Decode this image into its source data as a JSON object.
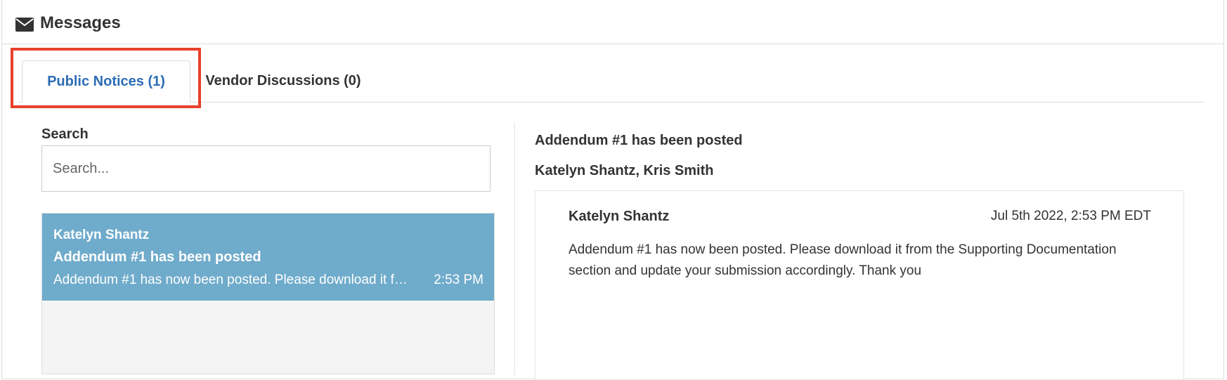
{
  "header": {
    "title": "Messages",
    "icon": "envelope-icon"
  },
  "tabs": [
    {
      "label": "Public Notices (1)",
      "active": true
    },
    {
      "label": "Vendor Discussions (0)",
      "active": false
    }
  ],
  "search": {
    "label": "Search",
    "placeholder": "Search...",
    "value": ""
  },
  "message_list": [
    {
      "sender": "Katelyn Shantz",
      "subject": "Addendum #1 has been posted",
      "preview": "Addendum #1 has now been posted. Please download it from the Supporting Documentation section and update your submission accordingly. Thank you",
      "time": "2:53 PM",
      "selected": true
    }
  ],
  "detail": {
    "subject": "Addendum #1 has been posted",
    "participants": "Katelyn Shantz, Kris Smith",
    "message": {
      "sender": "Katelyn Shantz",
      "date": "Jul 5th 2022, 2:53 PM EDT",
      "body": "Addendum #1 has now been posted. Please download it from the Supporting Documentation section and update your submission accordingly. Thank you"
    }
  },
  "colors": {
    "active_tab_text": "#2b6cb5",
    "selected_item_bg": "#6fabcb",
    "highlight_border": "#e8412c"
  }
}
